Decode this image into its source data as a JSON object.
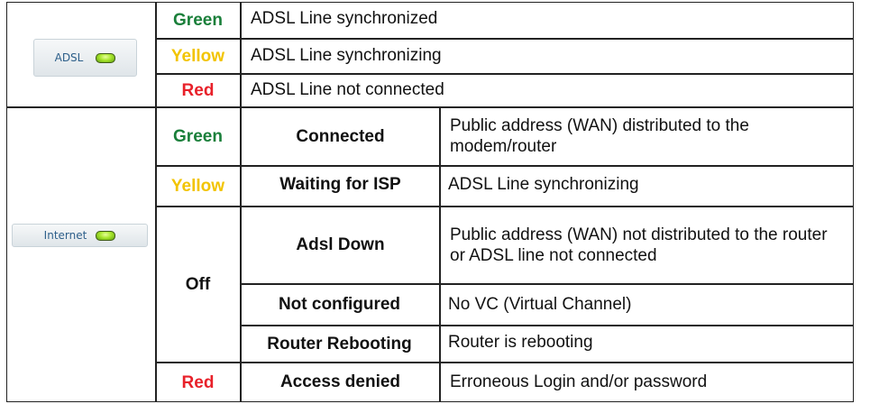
{
  "adsl": {
    "badge": {
      "label": "ADSL",
      "led_icon": "green-led-icon",
      "led_color": "#a8e62c"
    },
    "rows": [
      {
        "color_label": "Green",
        "color": "#1a7f3a",
        "description": "ADSL Line synchronized"
      },
      {
        "color_label": "Yellow",
        "color": "#f2c400",
        "description": "ADSL Line synchronizing"
      },
      {
        "color_label": "Red",
        "color": "#e8212a",
        "description": "ADSL Line not connected"
      }
    ]
  },
  "internet": {
    "badge": {
      "label": "Internet",
      "led_icon": "green-led-icon",
      "led_color": "#a8e62c"
    },
    "rows": [
      {
        "color_label": "Green",
        "status": "Connected",
        "description": "Public address (WAN) distributed to the modem/router"
      },
      {
        "color_label": "Yellow",
        "status": "Waiting for ISP",
        "description": "ADSL Line synchronizing"
      },
      {
        "color_label": "Off",
        "status": "Adsl Down",
        "description": "Public address (WAN) not distributed to the router or ADSL line not connected"
      },
      {
        "color_label": "Off",
        "status": "Not configured",
        "description": "No VC (Virtual Channel)"
      },
      {
        "color_label": "Off",
        "status": "Router Rebooting",
        "description": "Router is rebooting"
      },
      {
        "color_label": "Red",
        "status": "Access denied",
        "description": "Erroneous Login and/or password"
      }
    ]
  }
}
